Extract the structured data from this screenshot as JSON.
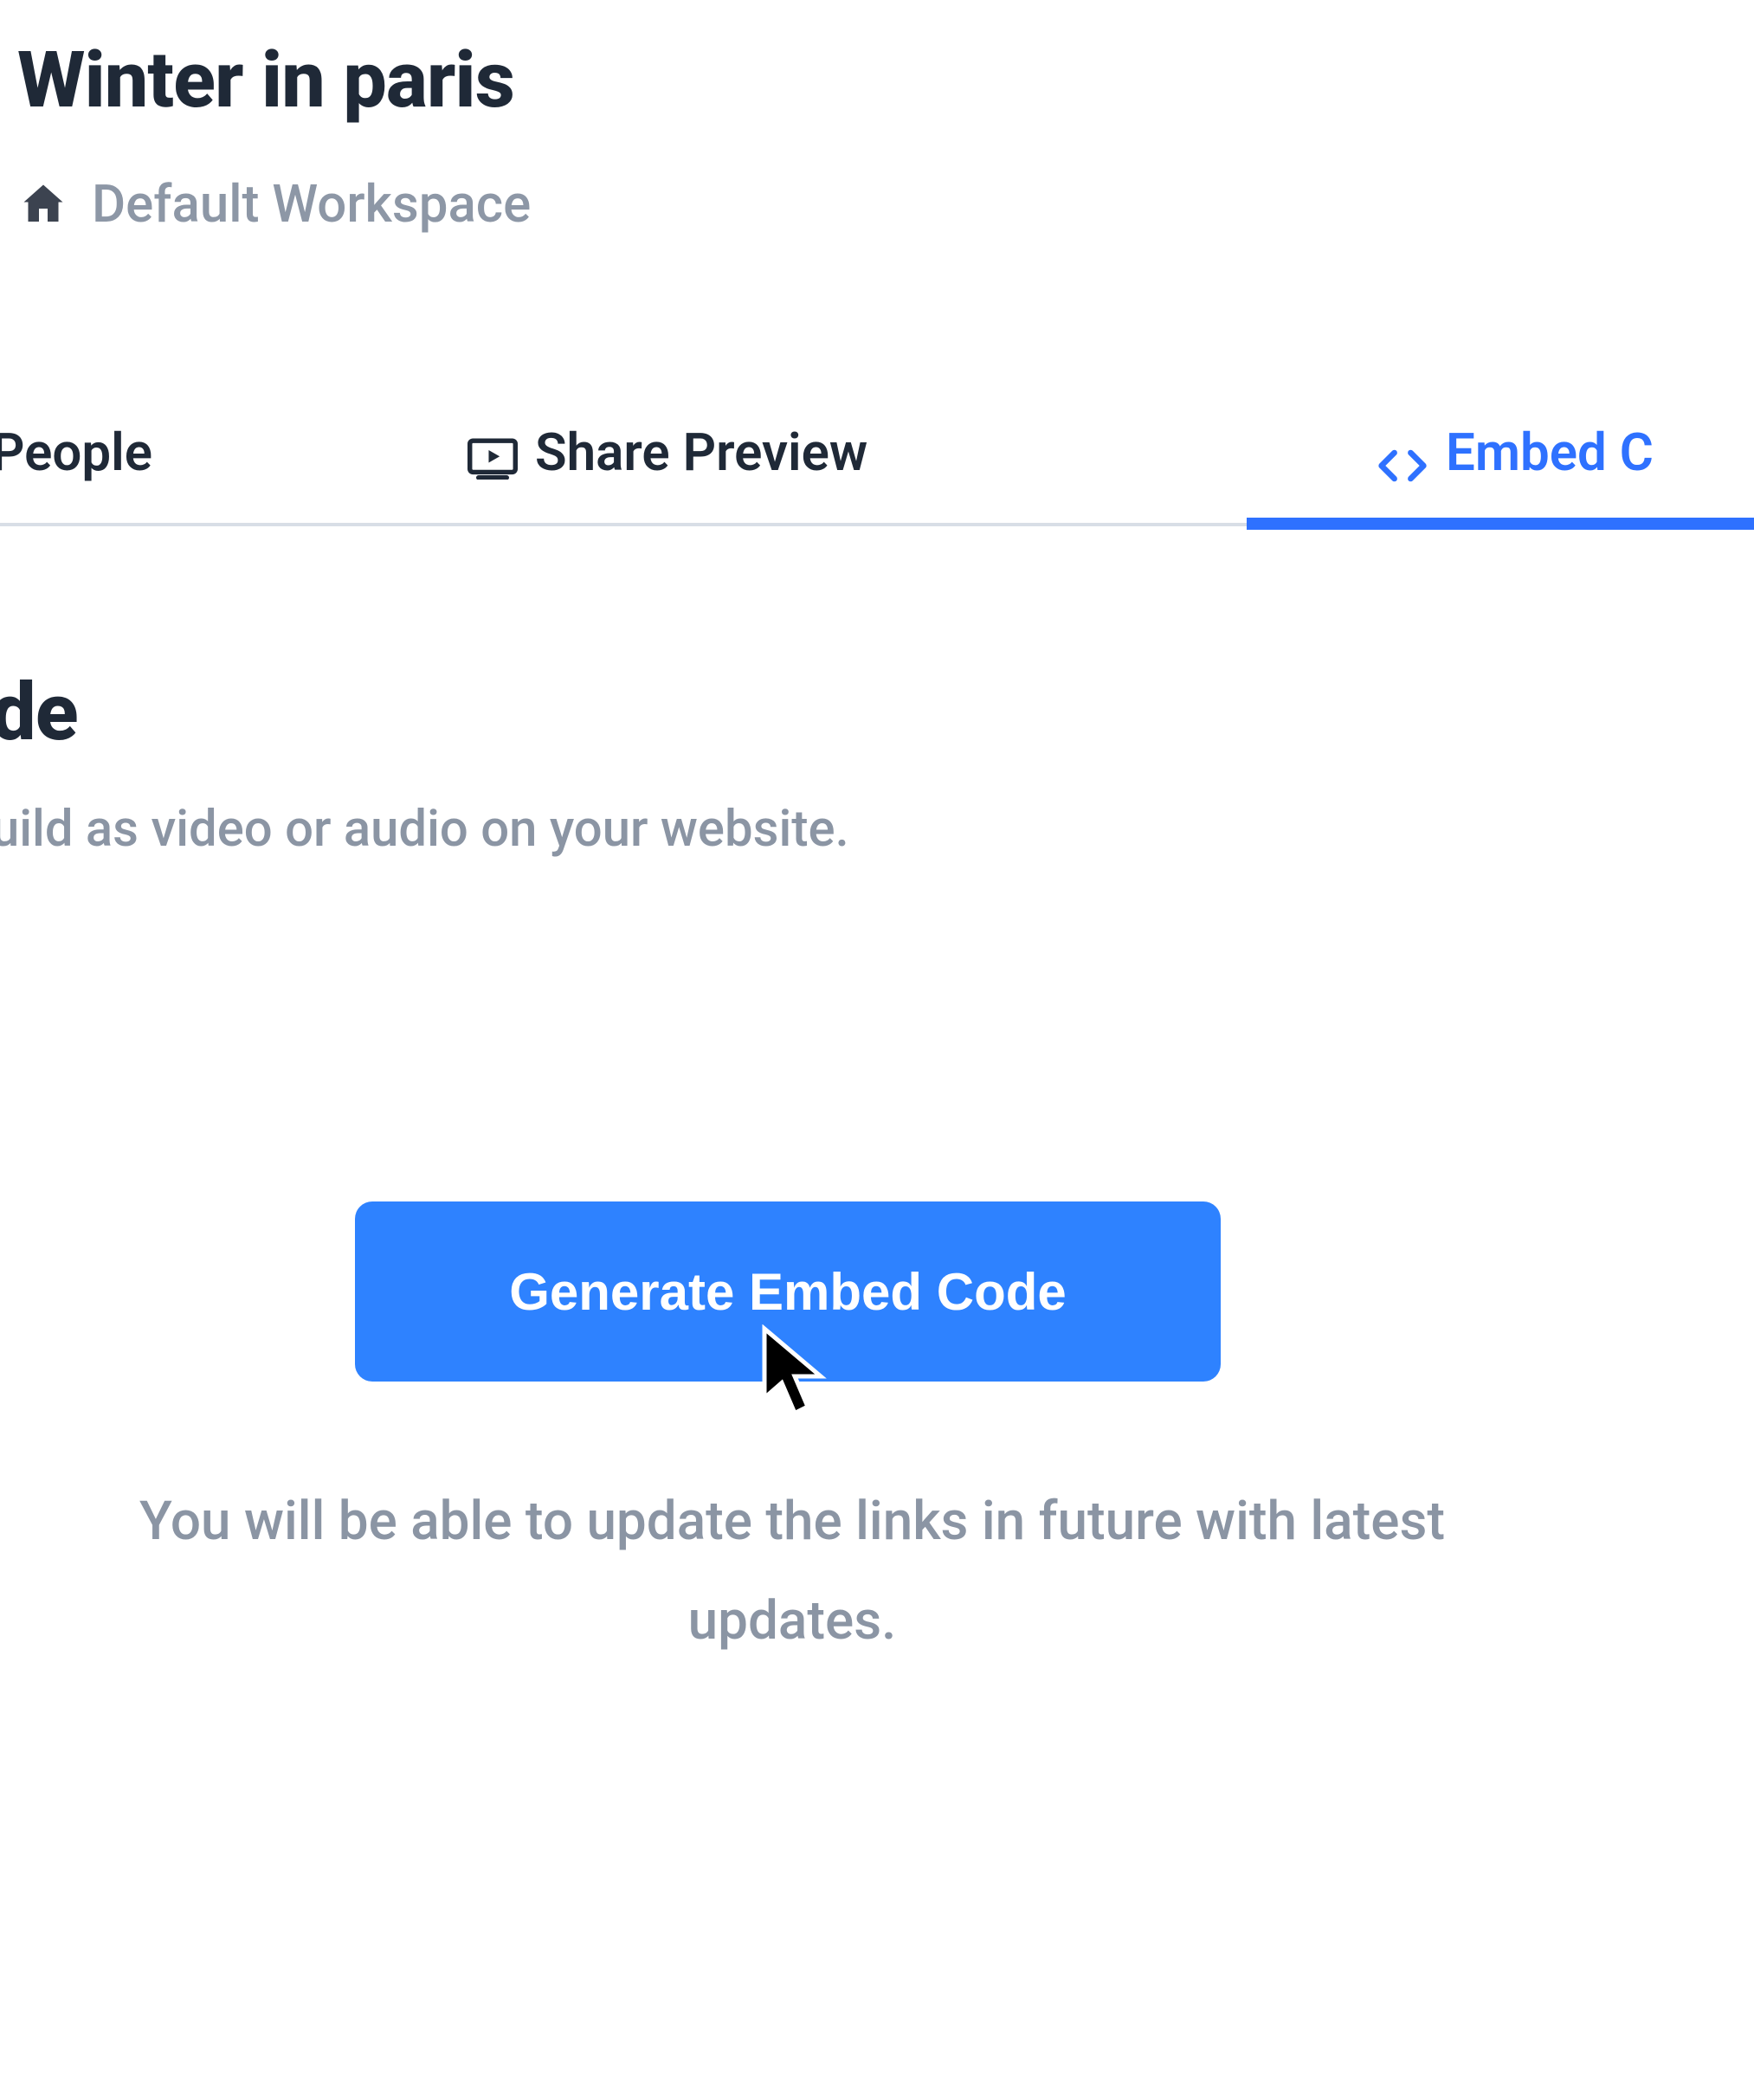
{
  "header": {
    "title": "Winter in paris",
    "workspace": "Default Workspace"
  },
  "tabs": {
    "people": {
      "label": "People"
    },
    "share_preview": {
      "label": "Share Preview"
    },
    "embed_code": {
      "label": "Embed C"
    }
  },
  "section": {
    "heading_fragment": "de",
    "subtitle_fragment": "uild as video or audio on your website."
  },
  "actions": {
    "generate_embed": {
      "label": "Generate Embed Code"
    }
  },
  "note": "You will be able to update the links in future with latest updates.",
  "colors": {
    "accent": "#2e71ff",
    "button": "#2e82ff",
    "muted": "#8b95a4",
    "text": "#1f2937",
    "divider": "#d8dee6"
  }
}
